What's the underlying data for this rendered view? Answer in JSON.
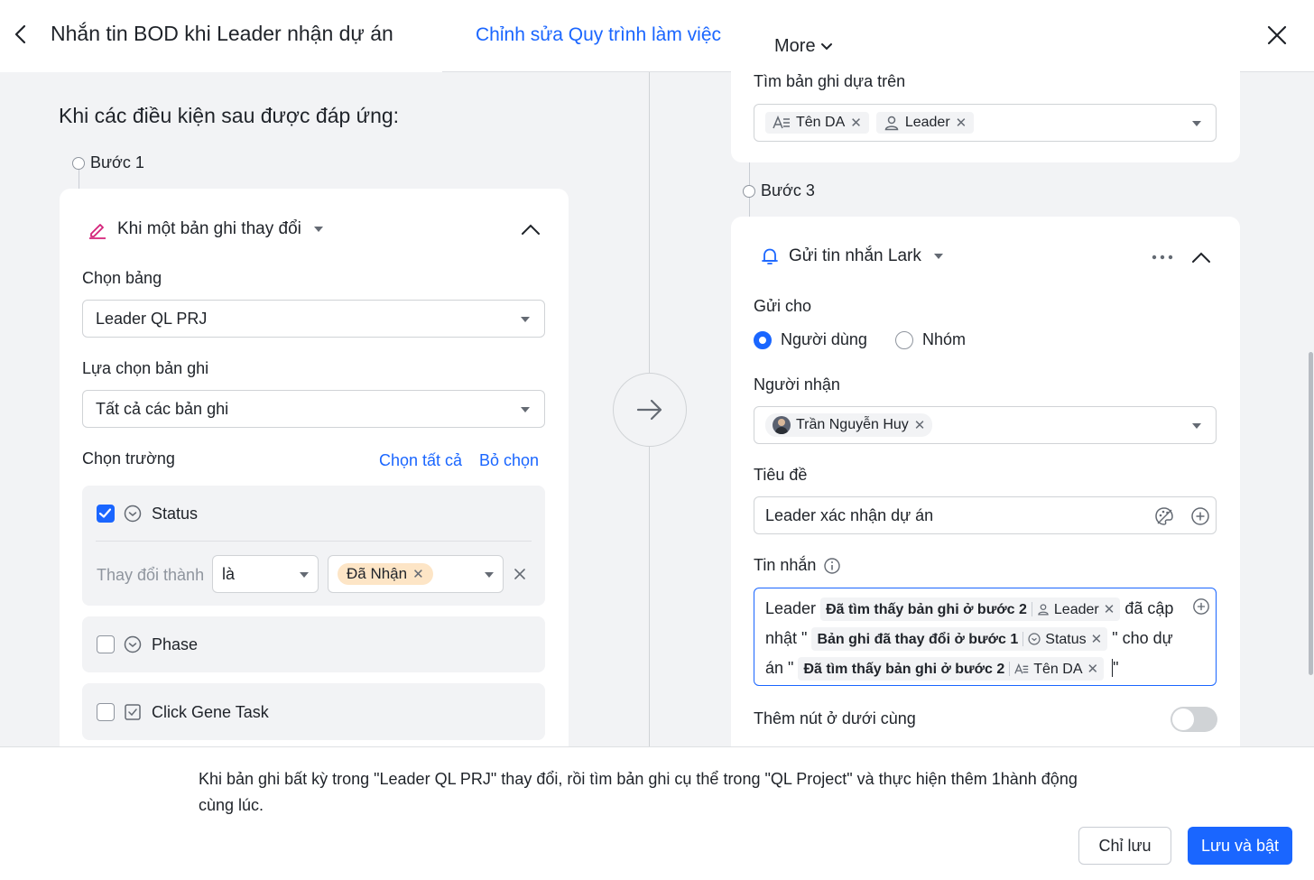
{
  "header": {
    "title": "Nhắn tin BOD khi Leader nhận dự án",
    "edit_tab": "Chỉnh sửa Quy trình làm việc",
    "more": "More"
  },
  "left": {
    "conditions_title": "Khi các điều kiện sau được đáp ứng:",
    "step1": "Bước 1",
    "trigger": "Khi một bản ghi thay đổi",
    "table_label": "Chọn bảng",
    "table_value": "Leader QL PRJ",
    "record_label": "Lựa chọn bản ghi",
    "record_value": "Tất cả các bản ghi",
    "fields_label": "Chọn trường",
    "select_all": "Chọn tất cả",
    "deselect": "Bỏ chọn",
    "fields": [
      {
        "name": "Status",
        "checked": true,
        "icon": "status-icon"
      },
      {
        "name": "Phase",
        "checked": false,
        "icon": "status-icon"
      },
      {
        "name": "Click Gene Task",
        "checked": false,
        "icon": "checkbox-field-icon"
      }
    ],
    "change_to_label": "Thay đổi thành",
    "operator": "là",
    "change_value": "Đã Nhận"
  },
  "right": {
    "find_label": "Tìm bản ghi dựa trên",
    "find_tags": [
      "Tên DA",
      "Leader"
    ],
    "step3": "Bước 3",
    "action": "Gửi tin nhắn Lark",
    "send_to_label": "Gửi cho",
    "radio_user": "Người dùng",
    "radio_group": "Nhóm",
    "recipient_label": "Người nhận",
    "recipient": "Trần Nguyễn Huy",
    "subject_label": "Tiêu đề",
    "subject_value": "Leader xác nhận dự án",
    "message_label": "Tin nhắn",
    "msg": {
      "t1": "Leader",
      "chip1_src": "Đã tìm thấy bản ghi ở bước 2",
      "chip1_field": "Leader",
      "t2": "đã cập nhật \"",
      "chip2_src": "Bản ghi đã thay đổi ở bước 1",
      "chip2_field": "Status",
      "t3": "\" cho dự án \"",
      "chip3_src": "Đã tìm thấy bản ghi ở bước 2",
      "chip3_field": "Tên DA",
      "t4": "\""
    },
    "bottom_button_label": "Thêm nút ở dưới cùng"
  },
  "footer": {
    "description": "Khi bản ghi bất kỳ trong \"Leader QL PRJ\" thay đổi, rồi tìm bản ghi cụ thể trong \"QL Project\" và thực hiện thêm 1hành động cùng lúc.",
    "save_only": "Chỉ lưu",
    "save_enable": "Lưu và bật"
  },
  "colors": {
    "accent": "#1a66ff",
    "tag_orange": "#fde5c6"
  }
}
